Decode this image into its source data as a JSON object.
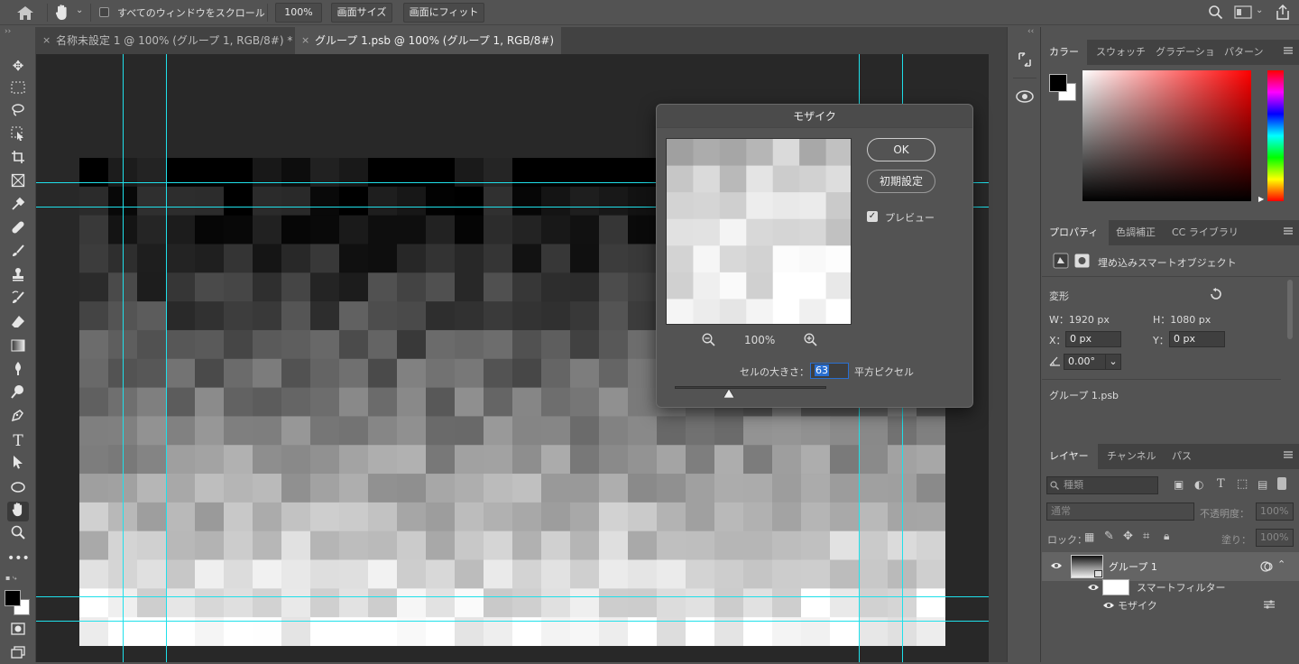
{
  "options_bar": {
    "scroll_all_label": "すべてのウィンドウをスクロール",
    "zoom_100_label": "100%",
    "fit_screen_label": "画面サイズ",
    "fill_screen_label": "画面にフィット"
  },
  "doc_tabs": [
    {
      "label": "名称未設定 1 @ 100% (グループ 1, RGB/8#) *"
    },
    {
      "label": "グループ 1.psb @ 100% (グループ 1, RGB/8#) *"
    }
  ],
  "mosaic_dialog": {
    "title": "モザイク",
    "ok_label": "OK",
    "reset_label": "初期設定",
    "preview_label": "プレビュー",
    "zoom_value": "100%",
    "cell_size_label": "セルの大きさ：",
    "cell_size_value": "63",
    "cell_size_unit": "平方ピクセル",
    "slider_fraction": 0.36
  },
  "color_panel": {
    "tabs": [
      "カラー",
      "スウォッチ",
      "グラデーショ",
      "パターン"
    ],
    "foreground": "#000000",
    "background": "#ffffff"
  },
  "properties_panel": {
    "tabs": [
      "プロパティ",
      "色調補正",
      "CC ライブラリ"
    ],
    "object_type": "埋め込みスマートオブジェクト",
    "transform_label": "変形",
    "w_label": "W：1920 px",
    "h_label": "H：1080 px",
    "x_label": "X：",
    "x_value": "0 px",
    "y_label": "Y：",
    "y_value": "0 px",
    "angle_value": "0.00°",
    "file_name": "グループ 1.psb"
  },
  "layers_panel": {
    "tabs": [
      "レイヤー",
      "チャンネル",
      "パス"
    ],
    "search_placeholder": "種類",
    "blend_mode": "通常",
    "opacity_label": "不透明度：",
    "opacity_value": "100%",
    "lock_label": "ロック：",
    "fill_label": "塗り：",
    "fill_value": "100%",
    "layer_name": "グループ 1",
    "smart_filter_label": "スマートフィルター",
    "filter_name": "モザイク"
  },
  "colors": {
    "guide": "#1fe0ea",
    "panel_bg": "#535353",
    "canvas_bg": "#282828"
  }
}
